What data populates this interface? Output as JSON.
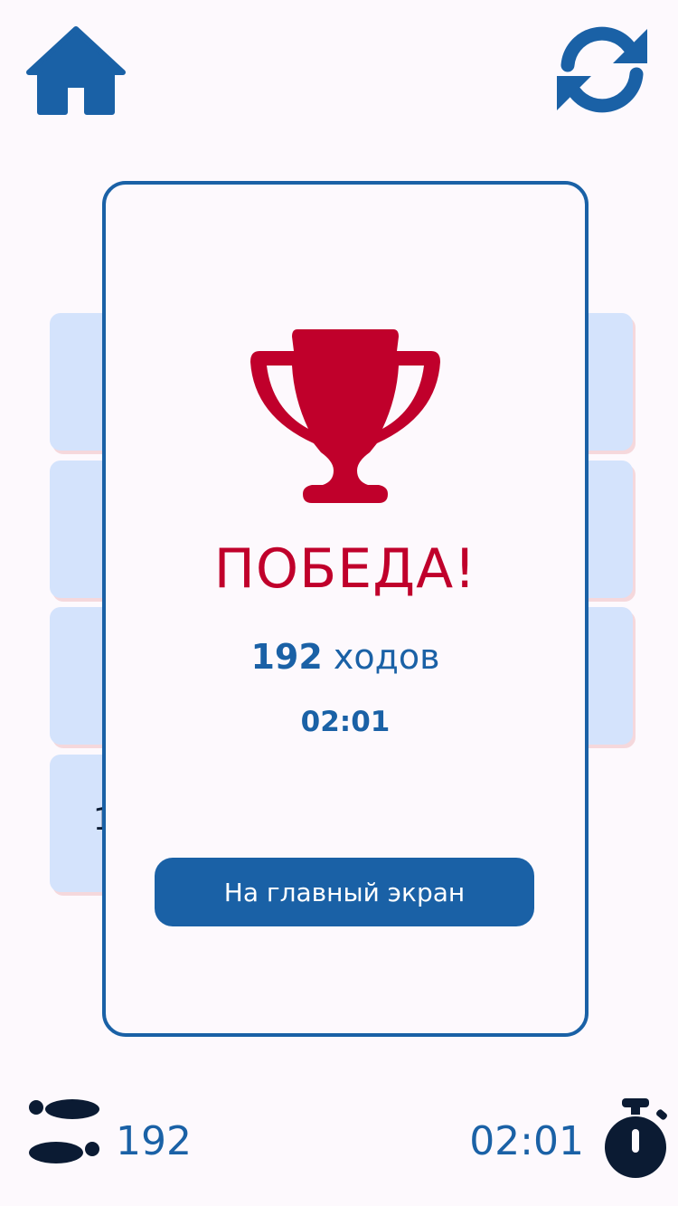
{
  "toolbar": {
    "home_icon": "home-icon",
    "restart_icon": "restart-icon"
  },
  "board": {
    "partial_tile_text": "1"
  },
  "victory": {
    "title": "ПОБЕДА!",
    "moves_value": "192",
    "moves_label": "ходов",
    "time": "02:01",
    "button_label": "На главный экран",
    "icon": "trophy-icon"
  },
  "footer": {
    "moves_count": "192",
    "time": "02:01",
    "moves_icon": "footprints-icon",
    "timer_icon": "stopwatch-icon"
  },
  "colors": {
    "accent": "#1a61a6",
    "victory": "#c0002b",
    "tile": "#d4e3fc",
    "background": "#fdf9fd",
    "dark_icon": "#0b1b33"
  }
}
